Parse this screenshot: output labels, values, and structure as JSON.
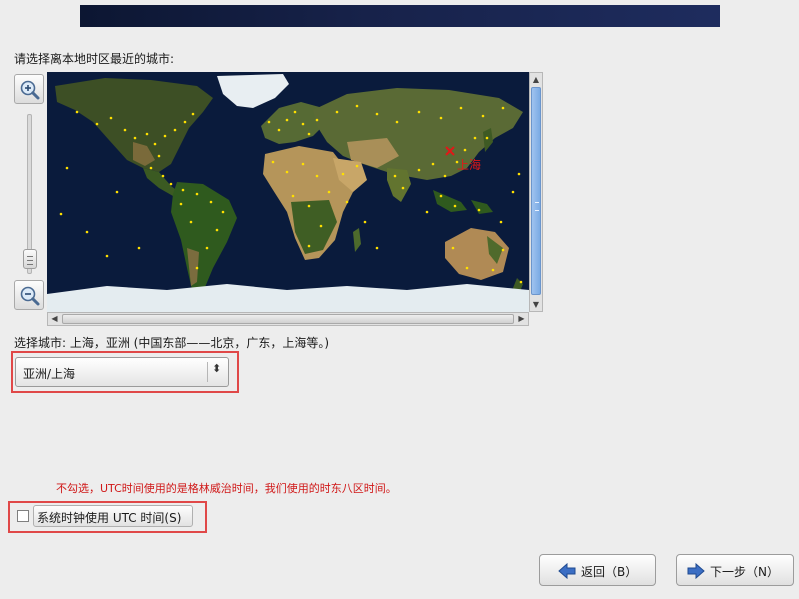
{
  "page": {
    "prompt": "请选择离本地时区最近的城市:",
    "selected_city_caption": "选择城市: 上海，亚洲 (中国东部——北京，广东，上海等。)",
    "timezone_select": {
      "value": "亚洲/上海"
    },
    "annotation_note": "不勾选，UTC时间使用的是格林威治时间，我们使用的时东八区时间。",
    "utc_checkbox": {
      "label": "系统时钟使用 UTC 时间(S)",
      "checked": false
    }
  },
  "map": {
    "selected_city_label": "上海",
    "marker_color": "#e01818",
    "city_dot_color": "#ffe000",
    "ocean_color": "#0a1b3c"
  },
  "buttons": {
    "back": "返回（B）",
    "next": "下一步（N）"
  },
  "icons": {
    "zoom_in": "zoom-in-icon",
    "zoom_out": "zoom-out-icon",
    "back_arrow": "left-arrow-icon",
    "next_arrow": "right-arrow-icon"
  }
}
